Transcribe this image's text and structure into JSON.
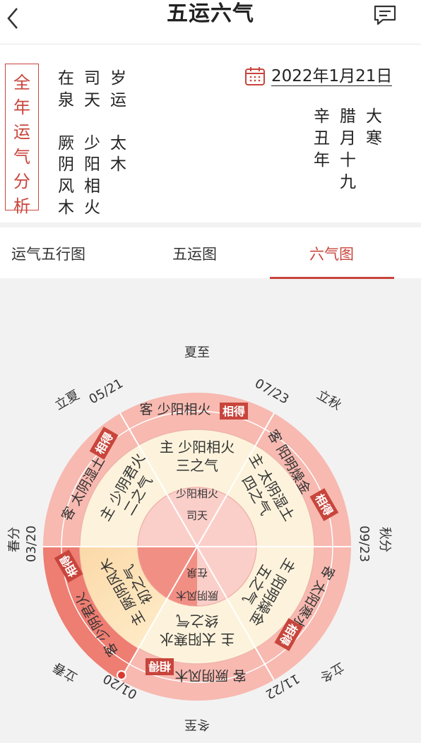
{
  "header": {
    "title": "五运六气"
  },
  "analysis_stamp": {
    "chars": [
      "全",
      "年",
      "运",
      "气",
      "分",
      "析"
    ]
  },
  "annual_grid": [
    "在",
    "司",
    "岁",
    "泉",
    "天",
    "运",
    "",
    "",
    "",
    "厥",
    "少",
    "太",
    "阴",
    "阳",
    "木",
    "风",
    "相",
    "",
    "木",
    "火",
    ""
  ],
  "date": {
    "solar": "2022年1月21日"
  },
  "lunar_grid": [
    "辛",
    "腊",
    "大",
    "丑",
    "月",
    "寒",
    "年",
    "十",
    "",
    "",
    "九",
    ""
  ],
  "tabs": [
    {
      "label": "运气五行图",
      "active": false
    },
    {
      "label": "五运图",
      "active": false
    },
    {
      "label": "六气图",
      "active": true
    }
  ],
  "wheel": {
    "solar_terms": {
      "summer": "夏至",
      "lixia": "立夏",
      "liqiu": "立秋",
      "spring": "春分",
      "autumn": "秋分",
      "lichun": "立春",
      "lidong": "立冬",
      "winter": "冬至"
    },
    "dates": {
      "d0521": "05/21",
      "d0723": "07/23",
      "d0320": "03/20",
      "d0923": "09/23",
      "d0120": "01/20",
      "d1122": "11/22"
    },
    "center": {
      "sitian": "司天",
      "shaoyang": "少阳相火",
      "zaiquan": "在泉",
      "jueyin": "厥阴风木"
    },
    "guest": {
      "g3": "客 少阳相火",
      "g4": "客 阳明燥金",
      "g5": "客 太阳寒水",
      "g6": "客 厥阴风木",
      "g1": "客 少阴君火",
      "g2": "客 太阴湿土"
    },
    "host": {
      "h3a": "主 少阳相火",
      "h3b": "三之气",
      "h4a": "主 太阴湿土",
      "h4b": "四之气",
      "h5a": "主 阳明燥金",
      "h5b": "五之气",
      "h6a": "主 太阳寒水",
      "h6b": "终之气",
      "h1a": "主 厥阴风木",
      "h1b": "初之气",
      "h2a": "主 少阴君火",
      "h2b": "二之气"
    },
    "badge": "相得",
    "colors": {
      "accent": "#c8453c",
      "outer": "#f6b8b0",
      "inner": "#fcefd6",
      "highlight": "#f08b80"
    }
  }
}
